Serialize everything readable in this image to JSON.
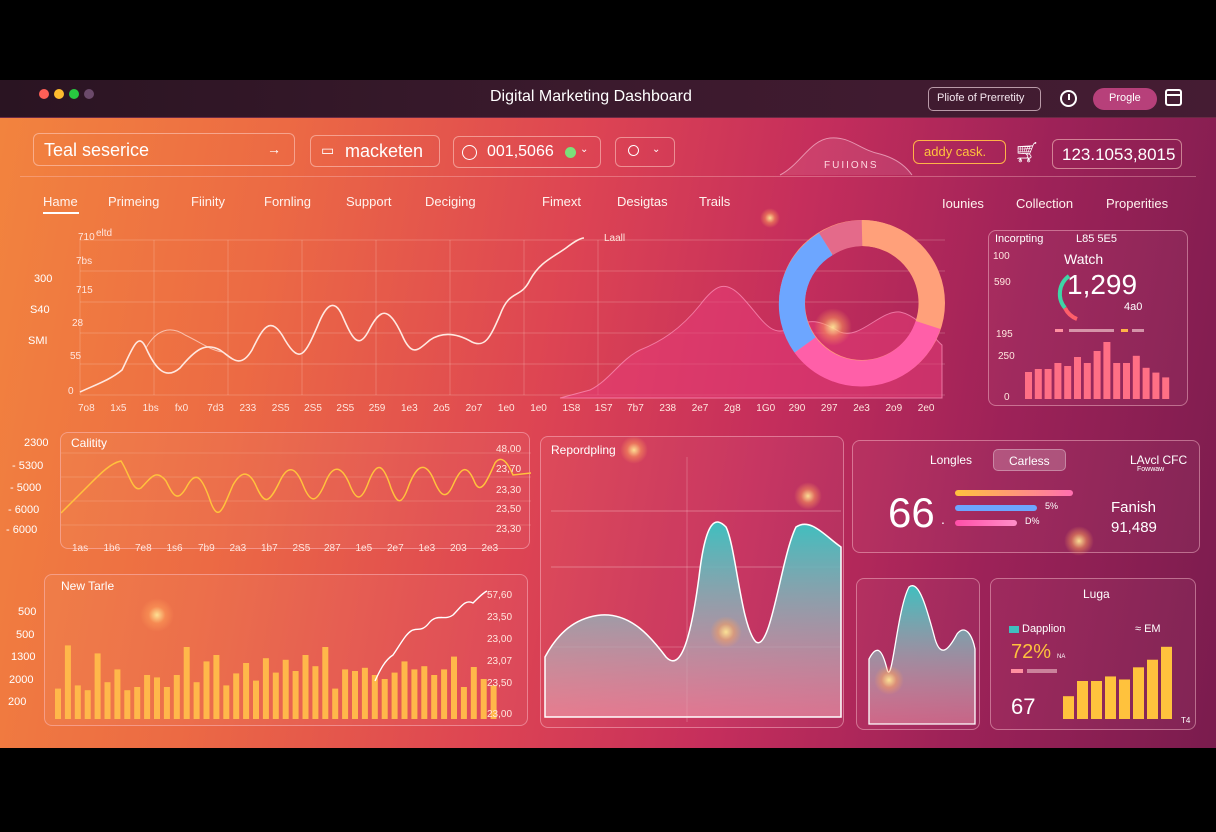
{
  "window": {
    "title": "Digital Marketing Dashboard",
    "profile_btn": "Pliofe of Prerretity",
    "user_btn": "Progle",
    "clock_icon": "clock-icon",
    "calendar_icon": "calendar-icon"
  },
  "toolbar": {
    "search_value": "Teal seserice",
    "market_btn": "macketen",
    "counter": "001,5066",
    "funnel_label": "FUIIONS",
    "add_task": "addy cask.",
    "total": "123.1053,8015"
  },
  "tabs": [
    "Hame",
    "Primeing",
    "Fiinity",
    "Fornling",
    "Support",
    "Deciging",
    "Fimext",
    "Desigtas",
    "Trails",
    "Iounies",
    "Collection",
    "Properities"
  ],
  "main_chart": {
    "label_a": "eltd",
    "label_b": "Laall",
    "y_outer": [
      "300",
      "S40",
      "SMI"
    ],
    "y_inner": [
      "710",
      "7bs",
      "715",
      "28",
      "55",
      "0"
    ],
    "x_ticks": [
      "7o8",
      "1x5",
      "1bs",
      "fx0",
      "7d3",
      "233",
      "2S5",
      "2S5",
      "2S5",
      "259",
      "1e3",
      "2o5",
      "2o7",
      "1e0",
      "1e0",
      "1S8",
      "1S7",
      "7b7",
      "238",
      "2e7",
      "2g8",
      "1G0",
      "290",
      "297",
      "2e3",
      "2o9",
      "2e0"
    ]
  },
  "watch": {
    "head_a": "Incorpting",
    "head_b": "L85 5E5",
    "title": "Watch",
    "value": "1,299",
    "sub": "4a0",
    "y": [
      "100",
      "590",
      "195",
      "250",
      "0"
    ],
    "bars": [
      0.45,
      0.5,
      0.5,
      0.6,
      0.55,
      0.7,
      0.6,
      0.8,
      0.95,
      0.6,
      0.6,
      0.72,
      0.52,
      0.44,
      0.36
    ]
  },
  "calitity": {
    "title": "Calitity",
    "y_left": [
      "2300",
      "- 5300",
      "- 5000",
      "- 6000",
      "- 6000"
    ],
    "y_right": [
      "48,00",
      "23,70",
      "23,30",
      "23,50",
      "23,30"
    ],
    "x": [
      "1as",
      "1b6",
      "7e8",
      "1s6",
      "7b9",
      "2a3",
      "1b7",
      "2S5",
      "287",
      "1e5",
      "2e7",
      "1e3",
      "203",
      "2e3"
    ]
  },
  "new_tails": {
    "title": "New Tarle",
    "y_left": [
      "500",
      "500",
      "1300",
      "2000",
      "200"
    ],
    "y_right": [
      "57,60",
      "23,50",
      "23,00",
      "23,07",
      "23,50",
      "23,00"
    ],
    "bars": [
      0.38,
      0.92,
      0.42,
      0.36,
      0.82,
      0.46,
      0.62,
      0.36,
      0.4,
      0.55,
      0.52,
      0.4,
      0.55,
      0.9,
      0.46,
      0.72,
      0.8,
      0.42,
      0.57,
      0.7,
      0.48,
      0.76,
      0.58,
      0.74,
      0.6,
      0.8,
      0.66,
      0.9,
      0.38,
      0.62,
      0.6,
      0.64,
      0.55,
      0.5,
      0.58,
      0.72,
      0.62,
      0.66,
      0.55,
      0.62,
      0.78,
      0.4,
      0.65,
      0.5,
      0.42
    ]
  },
  "reporting": {
    "title": "Repordpling"
  },
  "longles": {
    "title": "Longles",
    "tab": "Carless",
    "right_a": "LAvcl CFC",
    "right_b": "Fowwaw",
    "big": "66",
    "dot": ".",
    "pct_a": "5%",
    "pct_b": "D%",
    "right_title": "Fanish",
    "right_value": "91,489"
  },
  "lugg": {
    "title": "Luga",
    "legend_a": "Dapplion",
    "legend_b": "≈ EM",
    "pct": "72%",
    "pct_unit": "NA",
    "num": "67",
    "corner": "T4",
    "bars": [
      0.3,
      0.5,
      0.5,
      0.56,
      0.52,
      0.68,
      0.78,
      0.95
    ]
  },
  "colors": {
    "accent_yellow": "#ffc23d",
    "accent_blue": "#6da6ff",
    "accent_pink": "#ff5f9e",
    "teal": "#3fbfbf"
  }
}
